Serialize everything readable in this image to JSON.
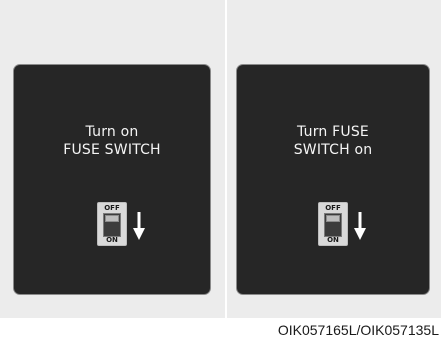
{
  "panels": [
    {
      "message_line1": "Turn on",
      "message_line2": "FUSE SWITCH",
      "switch_off_label": "OFF",
      "switch_on_label": "ON",
      "arrow_icon": "arrow-down-icon"
    },
    {
      "message_line1": "Turn FUSE",
      "message_line2": "SWITCH on",
      "switch_off_label": "OFF",
      "switch_on_label": "ON",
      "arrow_icon": "arrow-down-icon"
    }
  ],
  "caption": "OIK057165L/OIK057135L",
  "colors": {
    "panel_background": "#262626",
    "text": "#f5f5f5",
    "figure_background": "#ececec"
  }
}
